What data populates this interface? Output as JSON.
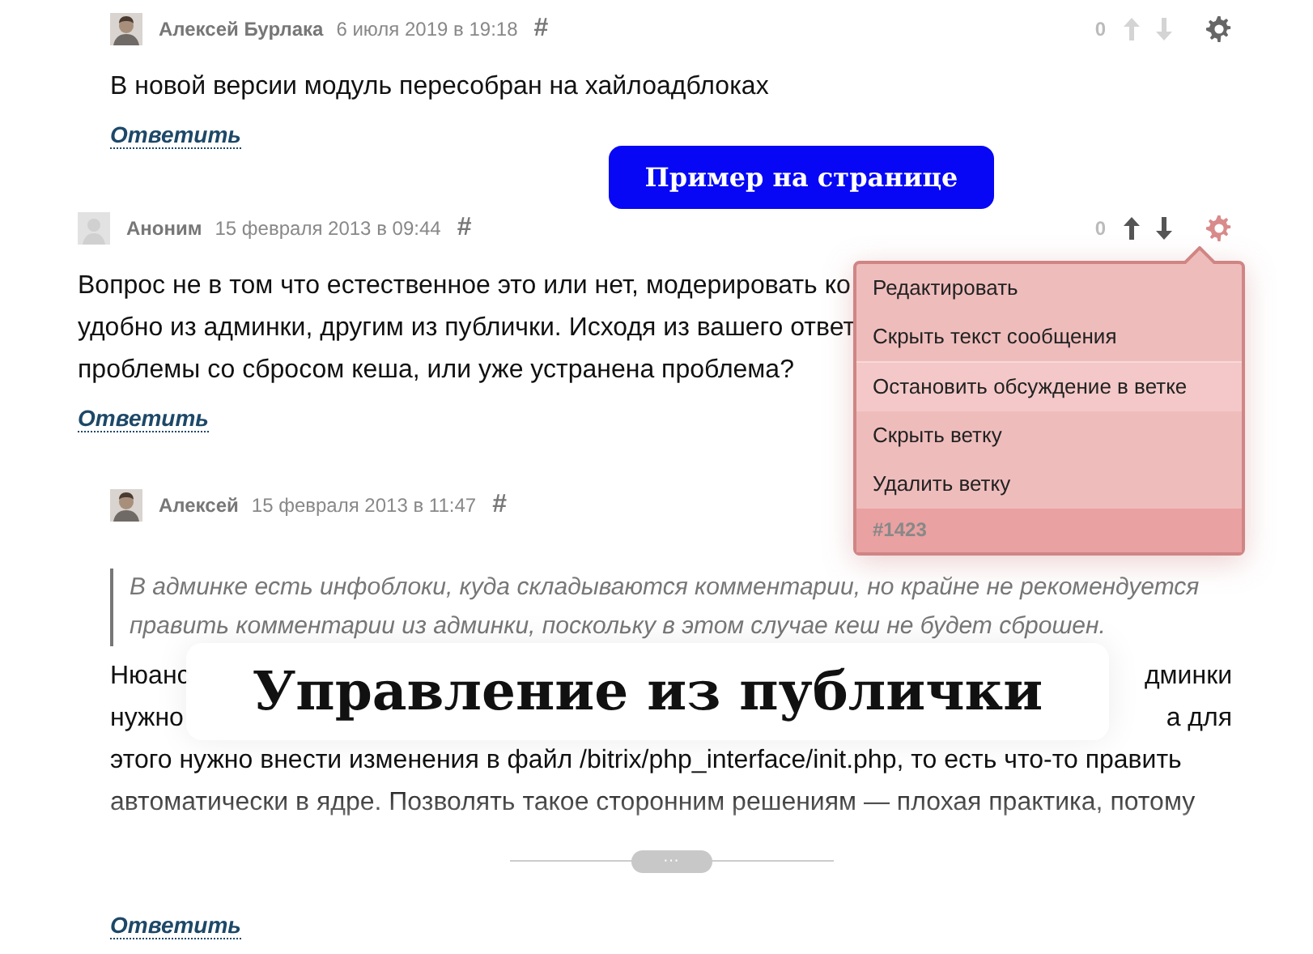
{
  "comments": [
    {
      "kind": "reply",
      "has_photo": true,
      "author": "Алексей Бурлака",
      "date": "6 июля 2019 в 19:18",
      "anchor": "#",
      "score": "0",
      "votes_active": false,
      "settings_open": false,
      "lines": [
        [
          "В новой версии модуль пересобран на хайлоадблоках"
        ]
      ],
      "reply": "Ответить"
    },
    {
      "kind": "root",
      "has_photo": false,
      "author": "Аноним",
      "date": "15 февраля 2013 в 09:44",
      "anchor": "#",
      "score": "0",
      "votes_active": true,
      "settings_open": true,
      "menu": {
        "items": [
          {
            "label": "Редактировать",
            "selected": false
          },
          {
            "label": "Скрыть текст сообщения",
            "selected": false
          },
          {
            "label": "Остановить обсуждение в ветке",
            "selected": true
          },
          {
            "label": "Скрыть ветку",
            "selected": false
          },
          {
            "label": "Удалить ветку",
            "selected": false
          }
        ],
        "footer": "#1423"
      },
      "lines": [
        [
          "Вопрос не в том что естественное это или нет, модерировать ко"
        ],
        [
          "удобно из админки, другим из публички. Исходя из вашего ответ"
        ],
        [
          "проблемы со сбросом кеша, или уже устранена проблема?"
        ]
      ],
      "reply": "Ответить",
      "children": [
        {
          "kind": "reply",
          "has_photo": true,
          "author": "Алексей",
          "date": "15 февраля 2013 в 11:47",
          "anchor": "#",
          "quote_lines": [
            "В админке есть инфоблоки, куда складываются комментарии, но крайне не рекомендуется",
            "править комментарии из админки, поскольку в этом случае кеш не будет сброшен."
          ],
          "lines": [
            [
              "Нюанс",
              "дминки"
            ],
            [
              "нужно",
              "а для"
            ],
            [
              "этого нужно внести изменения в файл /bitrix/php_interface/init.php, то есть что-то править"
            ],
            [
              "автоматически в ядре. Позволять такое сторонним решениям — плохая практика, потому"
            ]
          ],
          "collapsed": true,
          "expand_label": "···",
          "reply": "Ответить"
        }
      ]
    }
  ],
  "example_button": "Пример на странице",
  "caption": "Управление из публички"
}
